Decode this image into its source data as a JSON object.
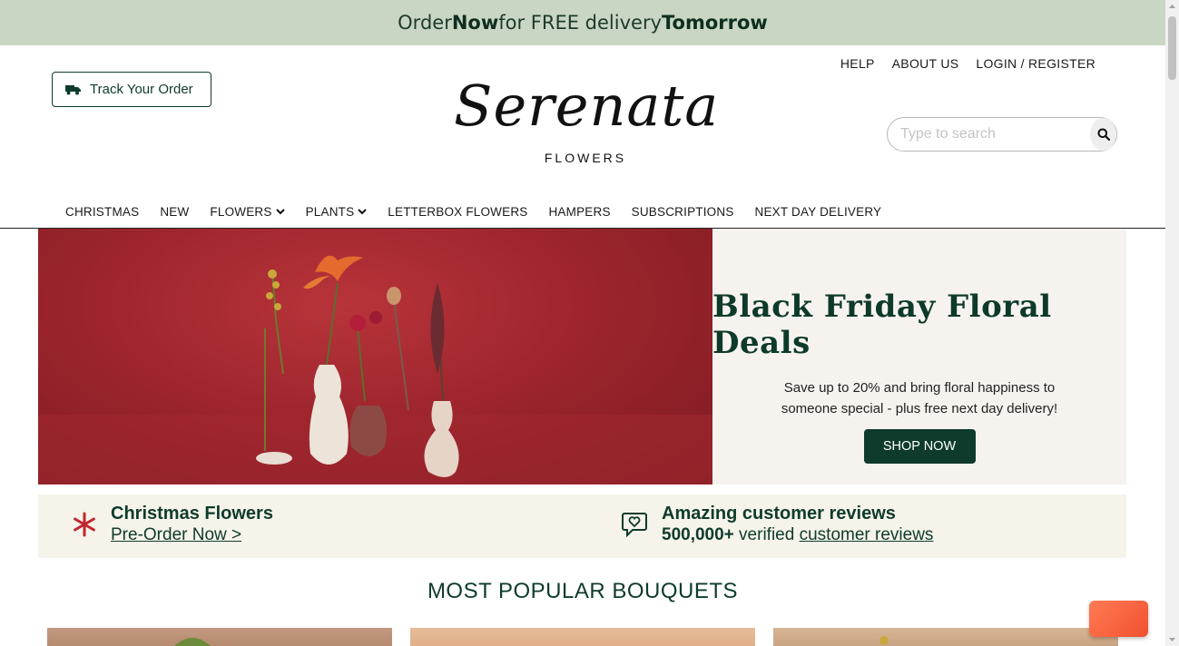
{
  "promo": {
    "p1": "Order ",
    "p2": "Now",
    "p3": " for FREE delivery ",
    "p4": "Tomorrow"
  },
  "header": {
    "track_label": "Track Your Order",
    "links": [
      "HELP",
      "ABOUT US",
      "LOGIN / REGISTER"
    ],
    "logo_script": "Serenata",
    "logo_sub": "FLOWERS",
    "search_placeholder": "Type to search"
  },
  "nav": {
    "items": [
      "CHRISTMAS",
      "NEW",
      "FLOWERS",
      "PLANTS",
      "LETTERBOX FLOWERS",
      "HAMPERS",
      "SUBSCRIPTIONS",
      "NEXT DAY DELIVERY"
    ]
  },
  "hero": {
    "title": "Black Friday Floral Deals",
    "text": "Save up to 20% and bring floral happiness to someone special - plus free next day delivery!",
    "cta": "SHOP NOW"
  },
  "features": {
    "christmas_title": "Christmas Flowers",
    "christmas_link": "Pre-Order Now >",
    "reviews_title": "Amazing customer reviews",
    "reviews_count": "500,000+",
    "reviews_mid": " verified ",
    "reviews_link": "customer reviews"
  },
  "section": {
    "title": "MOST POPULAR BOUQUETS"
  },
  "colors": {
    "brand_green": "#0e3b2b",
    "promo_bg": "#c9d6c3",
    "hero_red": "#9e252d",
    "snow_red": "#c0262d"
  }
}
